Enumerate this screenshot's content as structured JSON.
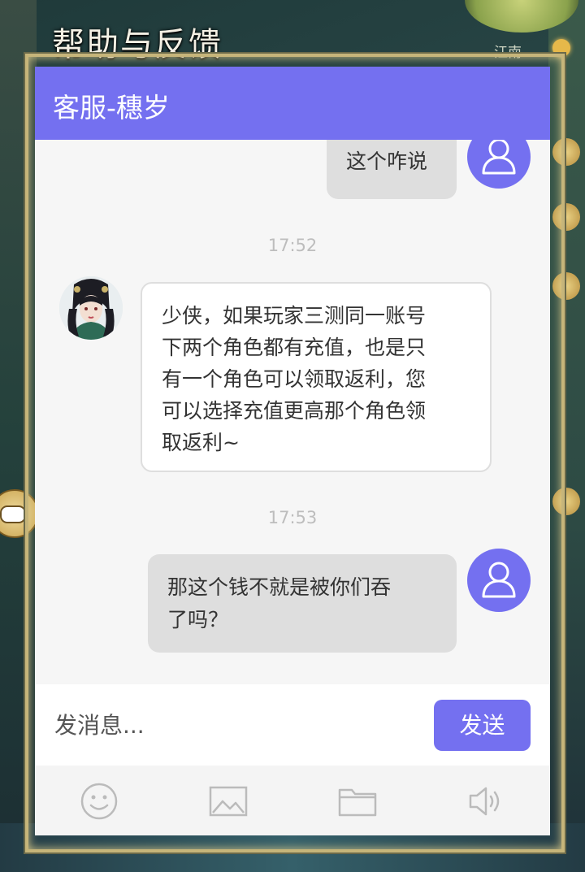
{
  "game": {
    "help_title": "帮助与反馈",
    "region_label": "江南"
  },
  "panel": {
    "title": "客服-穗岁"
  },
  "messages": [
    {
      "sender": "user",
      "text": "这个咋说"
    },
    {
      "timestamp": "17:52"
    },
    {
      "sender": "agent",
      "lines": [
        "少侠，如果玩家三测同一账号",
        "下两个角色都有充值，也是只",
        "有一个角色可以领取返利，您",
        "可以选择充值更高那个角色领",
        "取返利~"
      ]
    },
    {
      "timestamp": "17:53"
    },
    {
      "sender": "user",
      "lines": [
        "那这个钱不就是被你们吞",
        "了吗？"
      ]
    }
  ],
  "input": {
    "placeholder": "发消息...",
    "value": "",
    "send_label": "发送"
  },
  "toolbar": {
    "icons": [
      "emoji-icon",
      "image-icon",
      "folder-icon",
      "voice-icon"
    ]
  },
  "colors": {
    "accent": "#7470f0",
    "user_bubble": "#dedede",
    "agent_bubble": "#ffffff",
    "timestamp": "#bdbdbd"
  }
}
